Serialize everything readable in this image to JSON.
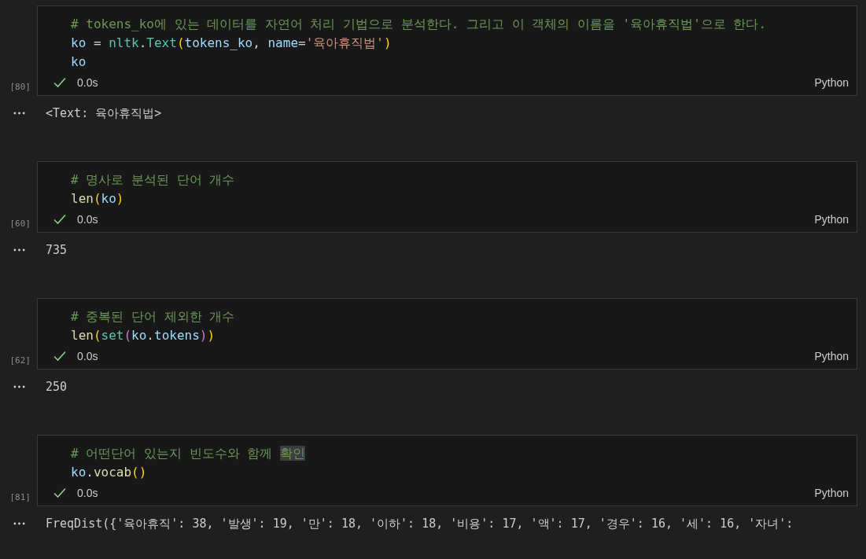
{
  "cells": [
    {
      "execution_count": "[80]",
      "duration": "0.0s",
      "succeeded": true,
      "language": "Python",
      "lines": [
        [
          {
            "kind": "comment",
            "text": "# tokens_ko에 있는 데이터를 자연어 처리 기법으로 분석한다. 그리고 이 객체의 이름을 '육아휴직법'으로 한다."
          }
        ],
        [
          {
            "kind": "var",
            "text": "ko"
          },
          {
            "kind": "op",
            "text": " = "
          },
          {
            "kind": "func",
            "text": "nltk"
          },
          {
            "kind": "op",
            "text": "."
          },
          {
            "kind": "func",
            "text": "Text"
          },
          {
            "kind": "bracket1",
            "text": "("
          },
          {
            "kind": "var",
            "text": "tokens_ko"
          },
          {
            "kind": "op",
            "text": ", "
          },
          {
            "kind": "var",
            "text": "name"
          },
          {
            "kind": "op",
            "text": "="
          },
          {
            "kind": "string",
            "text": "'육아휴직법'"
          },
          {
            "kind": "bracket1",
            "text": ")"
          }
        ],
        [
          {
            "kind": "var",
            "text": "ko"
          }
        ]
      ],
      "output": "<Text: 육아휴직법>"
    },
    {
      "execution_count": "[60]",
      "duration": "0.0s",
      "succeeded": true,
      "language": "Python",
      "lines": [
        [
          {
            "kind": "comment",
            "text": "# 명사로 분석된 단어 개수"
          }
        ],
        [
          {
            "kind": "fn",
            "text": "len"
          },
          {
            "kind": "bracket1",
            "text": "("
          },
          {
            "kind": "var",
            "text": "ko"
          },
          {
            "kind": "bracket1",
            "text": ")"
          }
        ]
      ],
      "output": "735"
    },
    {
      "execution_count": "[62]",
      "duration": "0.0s",
      "succeeded": true,
      "language": "Python",
      "lines": [
        [
          {
            "kind": "comment",
            "text": "# 중복된 단어 제외한 개수"
          }
        ],
        [
          {
            "kind": "fn",
            "text": "len"
          },
          {
            "kind": "bracket1",
            "text": "("
          },
          {
            "kind": "func",
            "text": "set"
          },
          {
            "kind": "bracket2",
            "text": "("
          },
          {
            "kind": "var",
            "text": "ko"
          },
          {
            "kind": "op",
            "text": "."
          },
          {
            "kind": "var",
            "text": "tokens"
          },
          {
            "kind": "bracket2",
            "text": ")"
          },
          {
            "kind": "bracket1",
            "text": ")"
          }
        ]
      ],
      "output": "250"
    },
    {
      "execution_count": "[81]",
      "duration": "0.0s",
      "succeeded": true,
      "language": "Python",
      "lines": [
        [
          {
            "kind": "comment",
            "text": "# 어떤단어 있는지 빈도수와 함께 "
          },
          {
            "kind": "comment-selected",
            "text": "확인"
          }
        ],
        [
          {
            "kind": "var",
            "text": "ko"
          },
          {
            "kind": "op",
            "text": "."
          },
          {
            "kind": "fn",
            "text": "vocab"
          },
          {
            "kind": "bracket1",
            "text": "()"
          }
        ]
      ],
      "output": "FreqDist({'육아휴직': 38, '발생': 19, '만': 18, '이하': 18, '비용': 17, '액': 17, '경우': 16, '세': 16, '자녀':"
    }
  ]
}
